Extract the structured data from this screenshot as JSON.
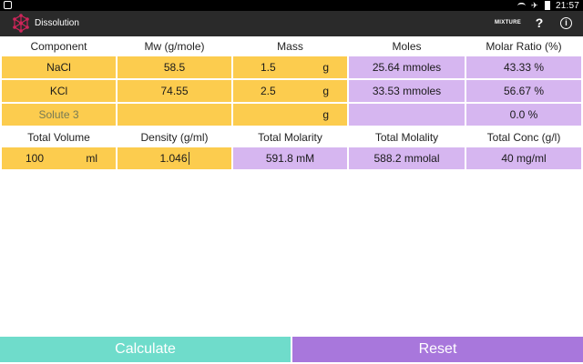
{
  "statusbar": {
    "time": "21:57",
    "plane": "✈"
  },
  "appbar": {
    "title": "Dissolution",
    "mixture_label": "MIXTURE",
    "help_label": "?",
    "info_label": "i"
  },
  "table": {
    "headers": [
      "Component",
      "Mw (g/mole)",
      "Mass",
      "Moles",
      "Molar Ratio (%)"
    ],
    "rows": [
      {
        "component": "NaCl",
        "mw": "58.5",
        "mass": "1.5",
        "mass_unit": "g",
        "moles": "25.64 mmoles",
        "ratio": "43.33 %"
      },
      {
        "component": "KCl",
        "mw": "74.55",
        "mass": "2.5",
        "mass_unit": "g",
        "moles": "33.53 mmoles",
        "ratio": "56.67 %"
      },
      {
        "component": "Solute 3",
        "mw": "",
        "mass": "",
        "mass_unit": "g",
        "moles": "",
        "ratio": "0.0 %"
      }
    ],
    "totals_headers": [
      "Total Volume",
      "Density (g/ml)",
      "Total Molarity",
      "Total Molality",
      "Total Conc (g/l)"
    ],
    "totals": {
      "volume": "100",
      "volume_unit": "ml",
      "density": "1.046",
      "molarity": "591.8 mM",
      "molality": "588.2 mmolal",
      "conc": "40 mg/ml"
    }
  },
  "buttons": {
    "calculate": "Calculate",
    "reset": "Reset"
  },
  "colors": {
    "input": "#fccc4e",
    "output": "#d6b6f0",
    "calculate": "#6fdccb",
    "reset": "#a877dc",
    "appbar": "#2a2a2a"
  }
}
